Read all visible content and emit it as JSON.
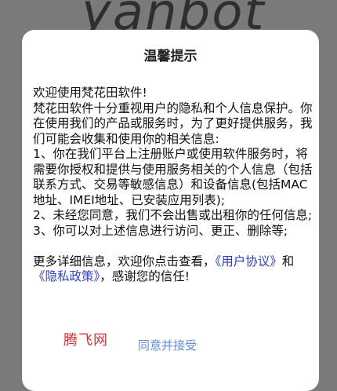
{
  "background": {
    "logo_text": "yanbot"
  },
  "dialog": {
    "title": "温馨提示",
    "paragraphs": [
      "欢迎使用梵花田软件!",
      "梵花田软件十分重视用户的隐私和个人信息保护。你在使用我们的产品或服务时，为了更好提供服务，我们可能会收集和使用你的相关信息:",
      "1、你在我们平台上注册账户或使用软件服务时，将需要你授权和提供与使用服务相关的个人信息（包括联系方式、交易等敏感信息）和设备信息(包括MAC地址、IMEI地址、已安装应用列表);",
      "2、未经您同意，我们不会出售或出租你的任何信息;",
      "3、你可以对上述信息进行访问、更正、删除等;"
    ],
    "more_info": {
      "prefix": "更多详细信息，欢迎你点击查看，",
      "user_agreement_link": "《用户协议》",
      "conjunction": "和",
      "privacy_policy_link": "《隐私政策》",
      "suffix": "，感谢您的信任!"
    },
    "agree_button_label": "同意并接受"
  },
  "watermark": {
    "text": "腾飞网"
  },
  "colors": {
    "overlay": "#7a7a7a",
    "link": "#2a3fd0",
    "agree_button": "#5f8fdc",
    "watermark": "#d0343a"
  }
}
